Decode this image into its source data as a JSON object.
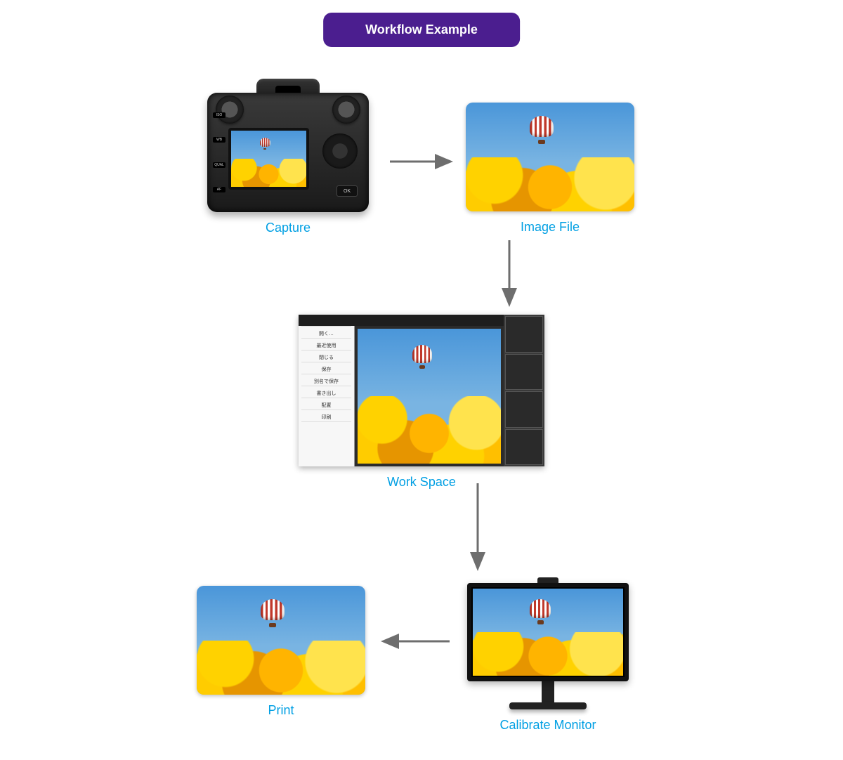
{
  "header": {
    "title": "Workflow Example"
  },
  "steps": {
    "capture": {
      "label": "Capture"
    },
    "imageFile": {
      "label": "Image File"
    },
    "workspace": {
      "label": "Work Space"
    },
    "monitor": {
      "label": "Calibrate Monitor"
    },
    "print": {
      "label": "Print"
    }
  },
  "flow_order": [
    "capture",
    "imageFile",
    "workspace",
    "monitor",
    "print"
  ]
}
